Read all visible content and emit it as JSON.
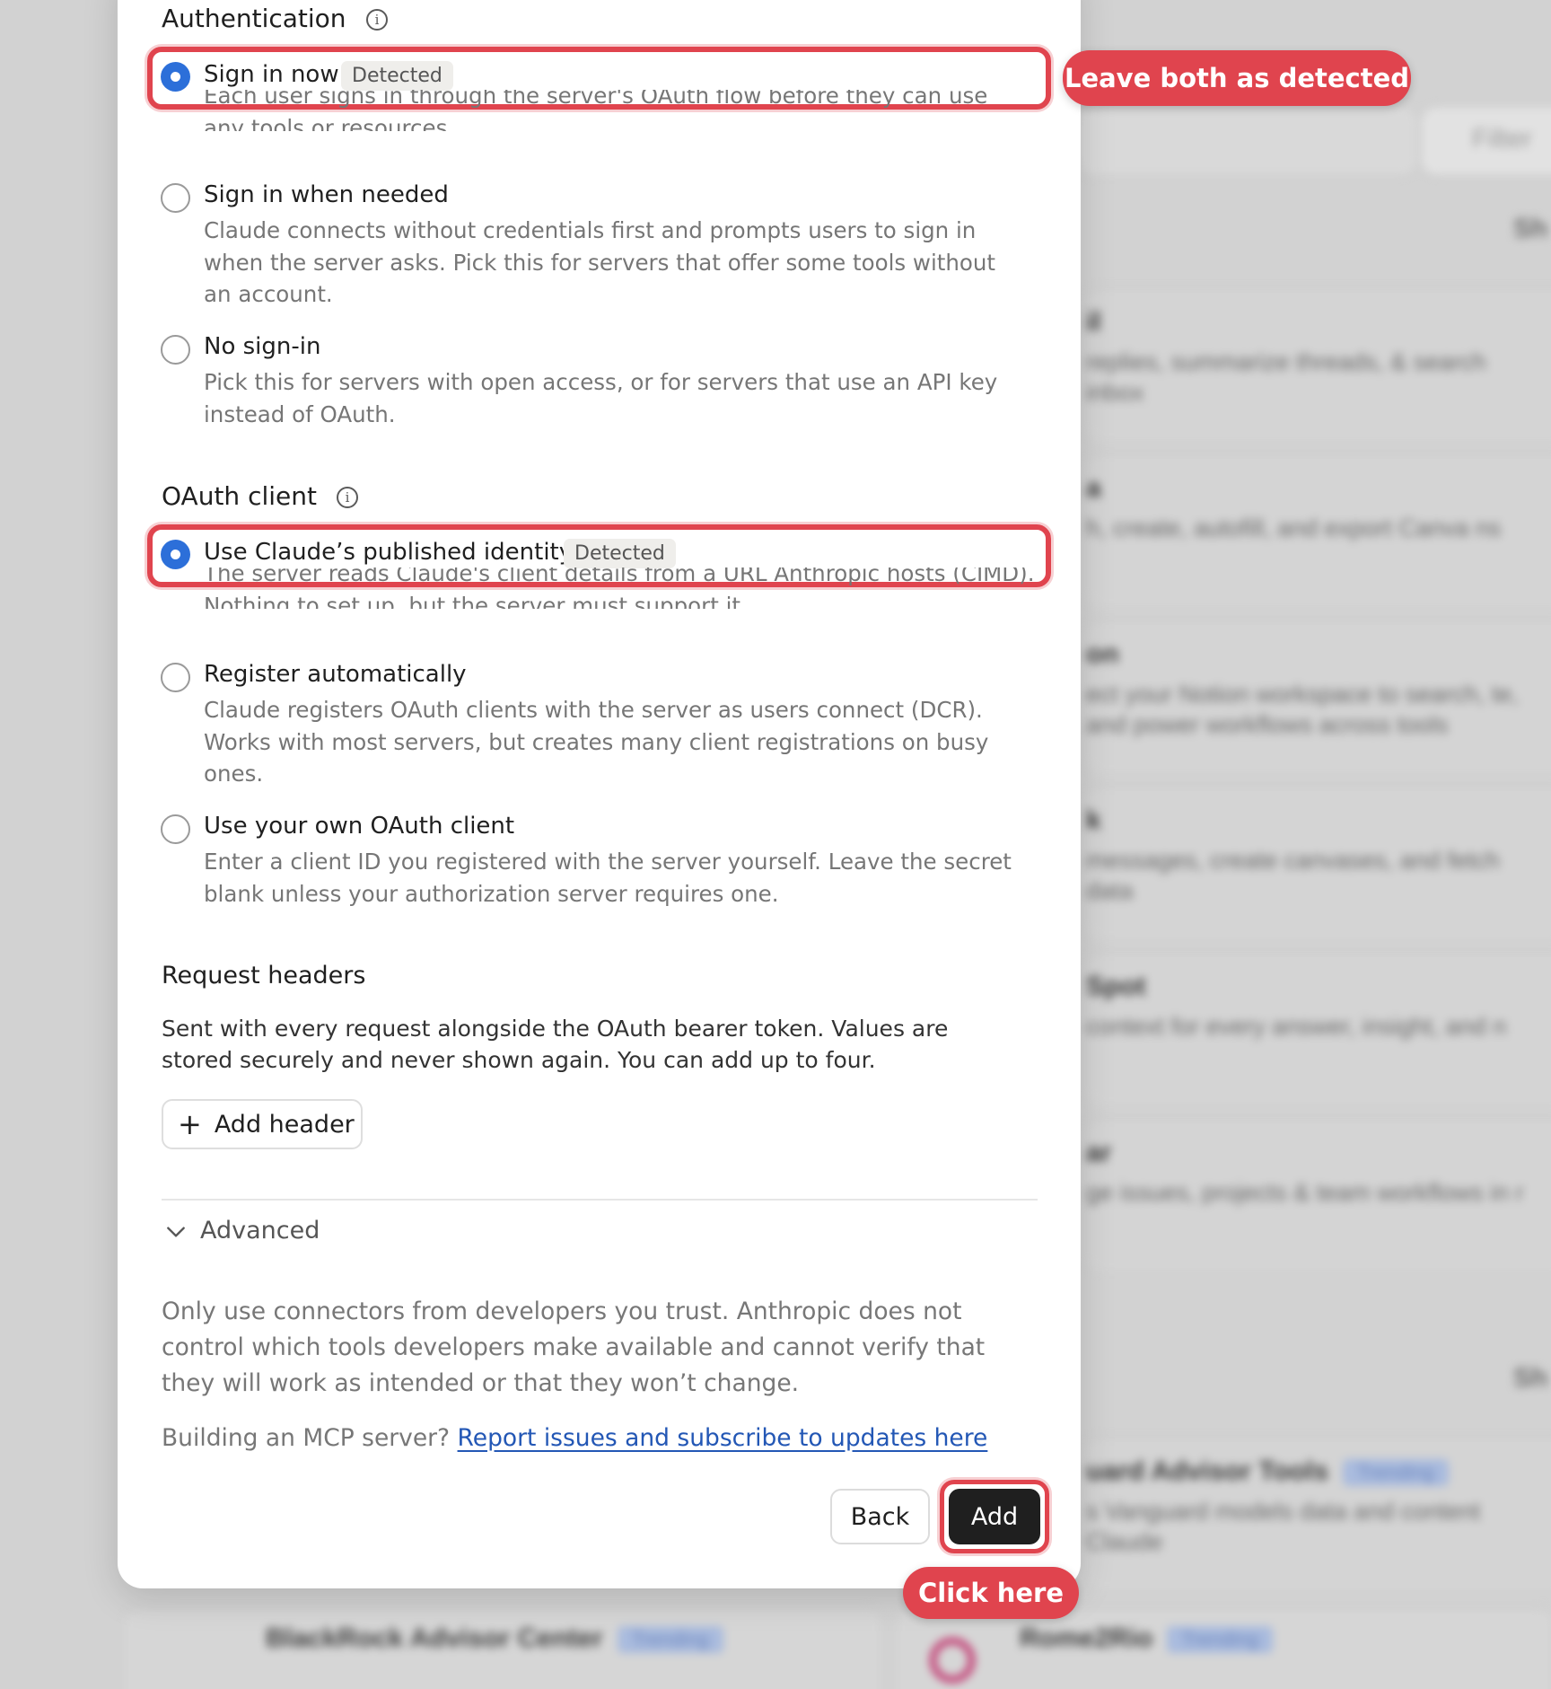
{
  "background": {
    "filter_label": "Filter",
    "section_heading": "Sh",
    "cards": [
      {
        "title": "il",
        "desc": "replies, summarize threads, & search inbox"
      },
      {
        "title": "a",
        "desc": "h, create, autofill, and export Canva ns"
      },
      {
        "title": "on",
        "desc": "ect your Notion workspace to search, te, and power workflows across tools"
      },
      {
        "title": "k",
        "desc": "messages, create canvases, and fetch data"
      },
      {
        "title": "Spot",
        "desc": "context for every answer, insight, and n"
      },
      {
        "title": "ar",
        "desc": "ge issues, projects & team workflows in r"
      },
      {
        "title": "uard Advisor Tools",
        "desc": "s Vanguard models data and content Claude",
        "tag": "Trending"
      }
    ],
    "bottom_cards": [
      {
        "title": "BlackRock Advisor Center",
        "tag": "Trending"
      },
      {
        "title": "Rome2Rio",
        "tag": "Trending"
      }
    ]
  },
  "authentication": {
    "title": "Authentication",
    "info_icon": "info-icon",
    "options": [
      {
        "label": "Sign in now",
        "badge": "Detected",
        "selected": true,
        "desc": "Each user signs in through the server's OAuth flow before they can use any tools or resources."
      },
      {
        "label": "Sign in when needed",
        "selected": false,
        "desc": "Claude connects without credentials first and prompts users to sign in when the server asks. Pick this for servers that offer some tools without an account."
      },
      {
        "label": "No sign-in",
        "selected": false,
        "desc": "Pick this for servers with open access, or for servers that use an API key instead of OAuth."
      }
    ]
  },
  "oauth_client": {
    "title": "OAuth client",
    "info_icon": "info-icon",
    "options": [
      {
        "label": "Use Claude’s published identity",
        "badge": "Detected",
        "selected": true,
        "desc": "The server reads Claude's client details from a URL Anthropic hosts (CIMD). Nothing to set up, but the server must support it."
      },
      {
        "label": "Register automatically",
        "selected": false,
        "desc": "Claude registers OAuth clients with the server as users connect (DCR). Works with most servers, but creates many client registrations on busy ones."
      },
      {
        "label": "Use your own OAuth client",
        "selected": false,
        "desc": "Enter a client ID you registered with the server yourself. Leave the secret blank unless your authorization server requires one."
      }
    ]
  },
  "request_headers": {
    "title": "Request headers",
    "desc": "Sent with every request alongside the OAuth bearer token. Values are stored securely and never shown again. You can add up to four.",
    "add_button": "Add header",
    "add_icon": "+"
  },
  "advanced": {
    "label": "Advanced",
    "icon": "chevron-down-icon"
  },
  "trust_notice": "Only use connectors from developers you trust. Anthropic does not control which tools developers make available and cannot verify that they will work as intended or that they won’t change.",
  "mcp_prompt": "Building an MCP server?",
  "mcp_link": "Report issues and subscribe to updates here",
  "footer": {
    "back": "Back",
    "add": "Add"
  },
  "callouts": {
    "top": "Leave both as detected",
    "bottom": "Click here"
  },
  "colors": {
    "accent_red": "#e0444e",
    "radio_blue": "#2c6fd9",
    "link_blue": "#2357b5",
    "primary_button": "#1f1f1f"
  }
}
